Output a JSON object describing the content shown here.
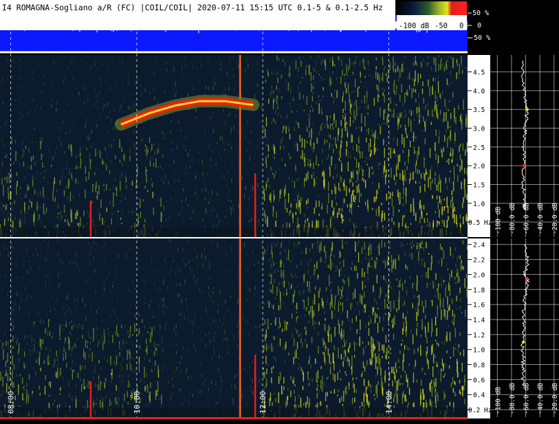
{
  "header": {
    "title": "I4 ROMAGNA-Sogliano a/R (FC) |COIL/COIL| 2020-07-11 15:15 UTC 0.1-5 & 0.1-2.5  Hz"
  },
  "colorbar": {
    "min_label": "-100 dB",
    "mid_label": "-50",
    "max_label": "0",
    "stops": [
      "#000000",
      "#0a1d3a",
      "#2c5a2c",
      "#9bb22a",
      "#e6e51a",
      "#e0201a",
      "#ff2020"
    ]
  },
  "waveform": {
    "ticks": [
      "50 %",
      "0",
      "-50 %"
    ],
    "background": "#0a19ff"
  },
  "colors": {
    "accent_red": "#e8201a",
    "low_green": "#3c5a2a",
    "bright_yellow": "#e8e020",
    "panel_bg": "#0b1a2c"
  },
  "chart_data": [
    {
      "type": "heatmap",
      "name_hint": "spectrogram-upper",
      "x_tick_labels": [
        "08:00",
        "10:00",
        "12:00",
        "14:00"
      ],
      "x_ticks": [
        8,
        10,
        12,
        14
      ],
      "xlim": [
        7.83,
        15.25
      ],
      "y_tick_labels": [
        "0.5 Hz",
        "1.0",
        "1.5",
        "2.0",
        "2.5",
        "3.0",
        "3.5",
        "4.0",
        "4.5"
      ],
      "y_ticks": [
        0.5,
        1.0,
        1.5,
        2.0,
        2.5,
        3.0,
        3.5,
        4.0,
        4.5
      ],
      "ylim": [
        0.1,
        4.95
      ],
      "features": {
        "arc_band": {
          "x": [
            9.75,
            10.2,
            10.6,
            11.0,
            11.4,
            11.85
          ],
          "y": [
            3.1,
            3.4,
            3.6,
            3.72,
            3.72,
            3.62
          ]
        },
        "vertical_lines": [
          9.27,
          11.64,
          11.88
        ],
        "low_activity_until": 10.4,
        "high_activity_from": 12.0
      }
    },
    {
      "type": "heatmap",
      "name_hint": "spectrogram-lower",
      "x_tick_labels": [
        "08:00",
        "10:00",
        "12:00",
        "14:00"
      ],
      "x_ticks": [
        8,
        10,
        12,
        14
      ],
      "xlim": [
        7.83,
        15.25
      ],
      "y_tick_labels": [
        "0.2 Hz",
        "0.4",
        "0.6",
        "0.8",
        "1.0",
        "1.2",
        "1.4",
        "1.6",
        "1.8",
        "2.0",
        "2.2",
        "2.4"
      ],
      "y_ticks": [
        0.2,
        0.4,
        0.6,
        0.8,
        1.0,
        1.2,
        1.4,
        1.6,
        1.8,
        2.0,
        2.2,
        2.4
      ],
      "ylim": [
        0.1,
        2.48
      ],
      "features": {
        "vertical_lines": [
          9.27,
          11.64,
          11.88
        ]
      }
    },
    {
      "type": "line",
      "name_hint": "spectrum-profile-upper",
      "x_tick_labels": [
        "-100 dB",
        "-80.0 dB",
        "-60.0 dB",
        "-40.0 dB",
        "-20.0 dB"
      ],
      "x_ticks": [
        -100,
        -80,
        -60,
        -40,
        -20
      ],
      "xlim": [
        -110,
        -13
      ],
      "y_ticks": [
        0.5,
        1.0,
        1.5,
        2.0,
        2.5,
        3.0,
        3.5,
        4.0,
        4.5
      ],
      "ylim": [
        0.1,
        4.95
      ],
      "profile": {
        "freq": [
          4.8,
          4.5,
          4.2,
          4.0,
          3.8,
          3.6,
          3.5,
          3.3,
          3.1,
          2.9,
          2.7,
          2.5,
          2.3,
          2.1,
          1.9,
          1.7,
          1.5,
          1.3,
          1.1,
          1.0,
          0.9,
          0.8
        ],
        "db": [
          -65,
          -64,
          -64,
          -63,
          -61,
          -59,
          -58,
          -59,
          -60,
          -61,
          -62,
          -63,
          -63,
          -62,
          -64,
          -64,
          -63,
          -63,
          -62,
          -61,
          -62,
          -61
        ]
      }
    },
    {
      "type": "line",
      "name_hint": "spectrum-profile-lower",
      "x_tick_labels": [
        "-100 dB",
        "-80.0 dB",
        "-60.0 dB",
        "-40.0 dB",
        "-20.0 dB"
      ],
      "x_ticks": [
        -100,
        -80,
        -60,
        -40,
        -20
      ],
      "xlim": [
        -110,
        -13
      ],
      "y_ticks": [
        0.2,
        0.4,
        0.6,
        0.8,
        1.0,
        1.2,
        1.4,
        1.6,
        1.8,
        2.0,
        2.2,
        2.4
      ],
      "ylim": [
        0.1,
        2.48
      ],
      "profile": {
        "freq": [
          2.4,
          2.3,
          2.2,
          2.1,
          2.0,
          1.95,
          1.9,
          1.8,
          1.7,
          1.6,
          1.5,
          1.4,
          1.3,
          1.2,
          1.1,
          1.0,
          0.9,
          0.8,
          0.7,
          0.6,
          0.5
        ],
        "db": [
          -60,
          -59,
          -58,
          -58,
          -62,
          -58,
          -57,
          -59,
          -61,
          -62,
          -63,
          -63,
          -62,
          -63,
          -64,
          -64,
          -63,
          -64,
          -63,
          -64,
          -63
        ]
      }
    }
  ]
}
